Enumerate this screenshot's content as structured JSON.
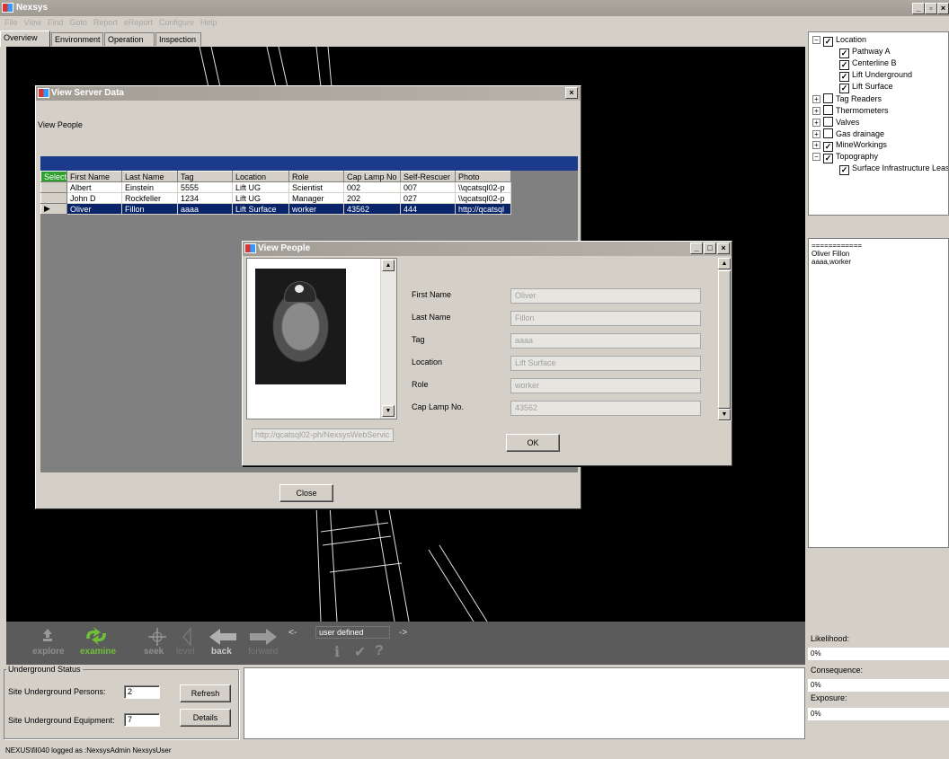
{
  "app": {
    "title": "Nexsys"
  },
  "menu": [
    "File",
    "View",
    "Find",
    "Goto",
    "Report",
    "eReport",
    "Configure",
    "Help"
  ],
  "tabs": [
    "Overview",
    "Environment",
    "Operation",
    "Inspection"
  ],
  "server_dialog": {
    "title": "View Server Data",
    "label": "View People",
    "columns": [
      "Select",
      "First Name",
      "Last Name",
      "Tag",
      "Location",
      "Role",
      "Cap Lamp No",
      "Self-Rescuer",
      "Photo"
    ],
    "rows": [
      [
        "",
        "Albert",
        "Einstein",
        "5555",
        "Lift UG",
        "Scientist",
        "002",
        "007",
        "\\\\qcatsql02-p"
      ],
      [
        "",
        "John D",
        "Rockfeller",
        "1234",
        "Lift UG",
        "Manager",
        "202",
        "027",
        "\\\\qcatsql02-p"
      ],
      [
        "▶",
        "Oliver",
        "Fillon",
        "aaaa",
        "Lift Surface",
        "worker",
        "43562",
        "444",
        "http://qcatsql"
      ]
    ],
    "close_label": "Close"
  },
  "people_dialog": {
    "title": "View People",
    "photo_url": "http://qcatsql02-ph/NexsysWebServic",
    "fields": [
      {
        "label": "First Name",
        "value": "Oliver"
      },
      {
        "label": "Last Name",
        "value": "Fillon"
      },
      {
        "label": "Tag",
        "value": "aaaa"
      },
      {
        "label": "Location",
        "value": "Lift Surface"
      },
      {
        "label": "Role",
        "value": "worker"
      },
      {
        "label": "Cap Lamp No.",
        "value": "43562"
      }
    ],
    "ok_label": "OK"
  },
  "tree": [
    {
      "label": "Location",
      "expander": "−",
      "checked": true,
      "indent": 0
    },
    {
      "label": "Pathway A",
      "checked": true,
      "indent": 1
    },
    {
      "label": "Centerline B",
      "checked": true,
      "indent": 1
    },
    {
      "label": "Lift Underground",
      "checked": true,
      "indent": 1
    },
    {
      "label": "Lift Surface",
      "checked": true,
      "indent": 1
    },
    {
      "label": "Tag Readers",
      "expander": "+",
      "checked": false,
      "indent": 0
    },
    {
      "label": "Thermometers",
      "expander": "+",
      "checked": false,
      "indent": 0
    },
    {
      "label": "Valves",
      "expander": "+",
      "checked": false,
      "indent": 0
    },
    {
      "label": "Gas drainage",
      "expander": "+",
      "checked": false,
      "indent": 0
    },
    {
      "label": "MineWorkings",
      "expander": "+",
      "checked": true,
      "indent": 0
    },
    {
      "label": "Topography",
      "expander": "−",
      "checked": true,
      "indent": 0
    },
    {
      "label": "Surface Infrastructure Lease",
      "checked": true,
      "indent": 1
    }
  ],
  "info_panel": [
    "============",
    "Oliver Fillon",
    "aaaa,worker"
  ],
  "toolbar": {
    "explore": "explore",
    "examine": "examine",
    "seek": "seek",
    "level": "level",
    "back": "back",
    "forward": "forward",
    "prev": "<-",
    "next": "->",
    "viewpoint": "user defined"
  },
  "status": {
    "group_title": "Underground Status",
    "persons_label": "Site Underground Persons:",
    "persons_value": "2",
    "equipment_label": "Site Underground Equipment:",
    "equipment_value": "7",
    "refresh_label": "Refresh",
    "details_label": "Details"
  },
  "risk": {
    "likelihood_label": "Likelihood:",
    "likelihood_value": "0%",
    "consequence_label": "Consequence:",
    "consequence_value": "0%",
    "exposure_label": "Exposure:",
    "exposure_value": "0%"
  },
  "statusbar": "NEXUS\\fil040 logged as :NexsysAdmin NexsysUser"
}
